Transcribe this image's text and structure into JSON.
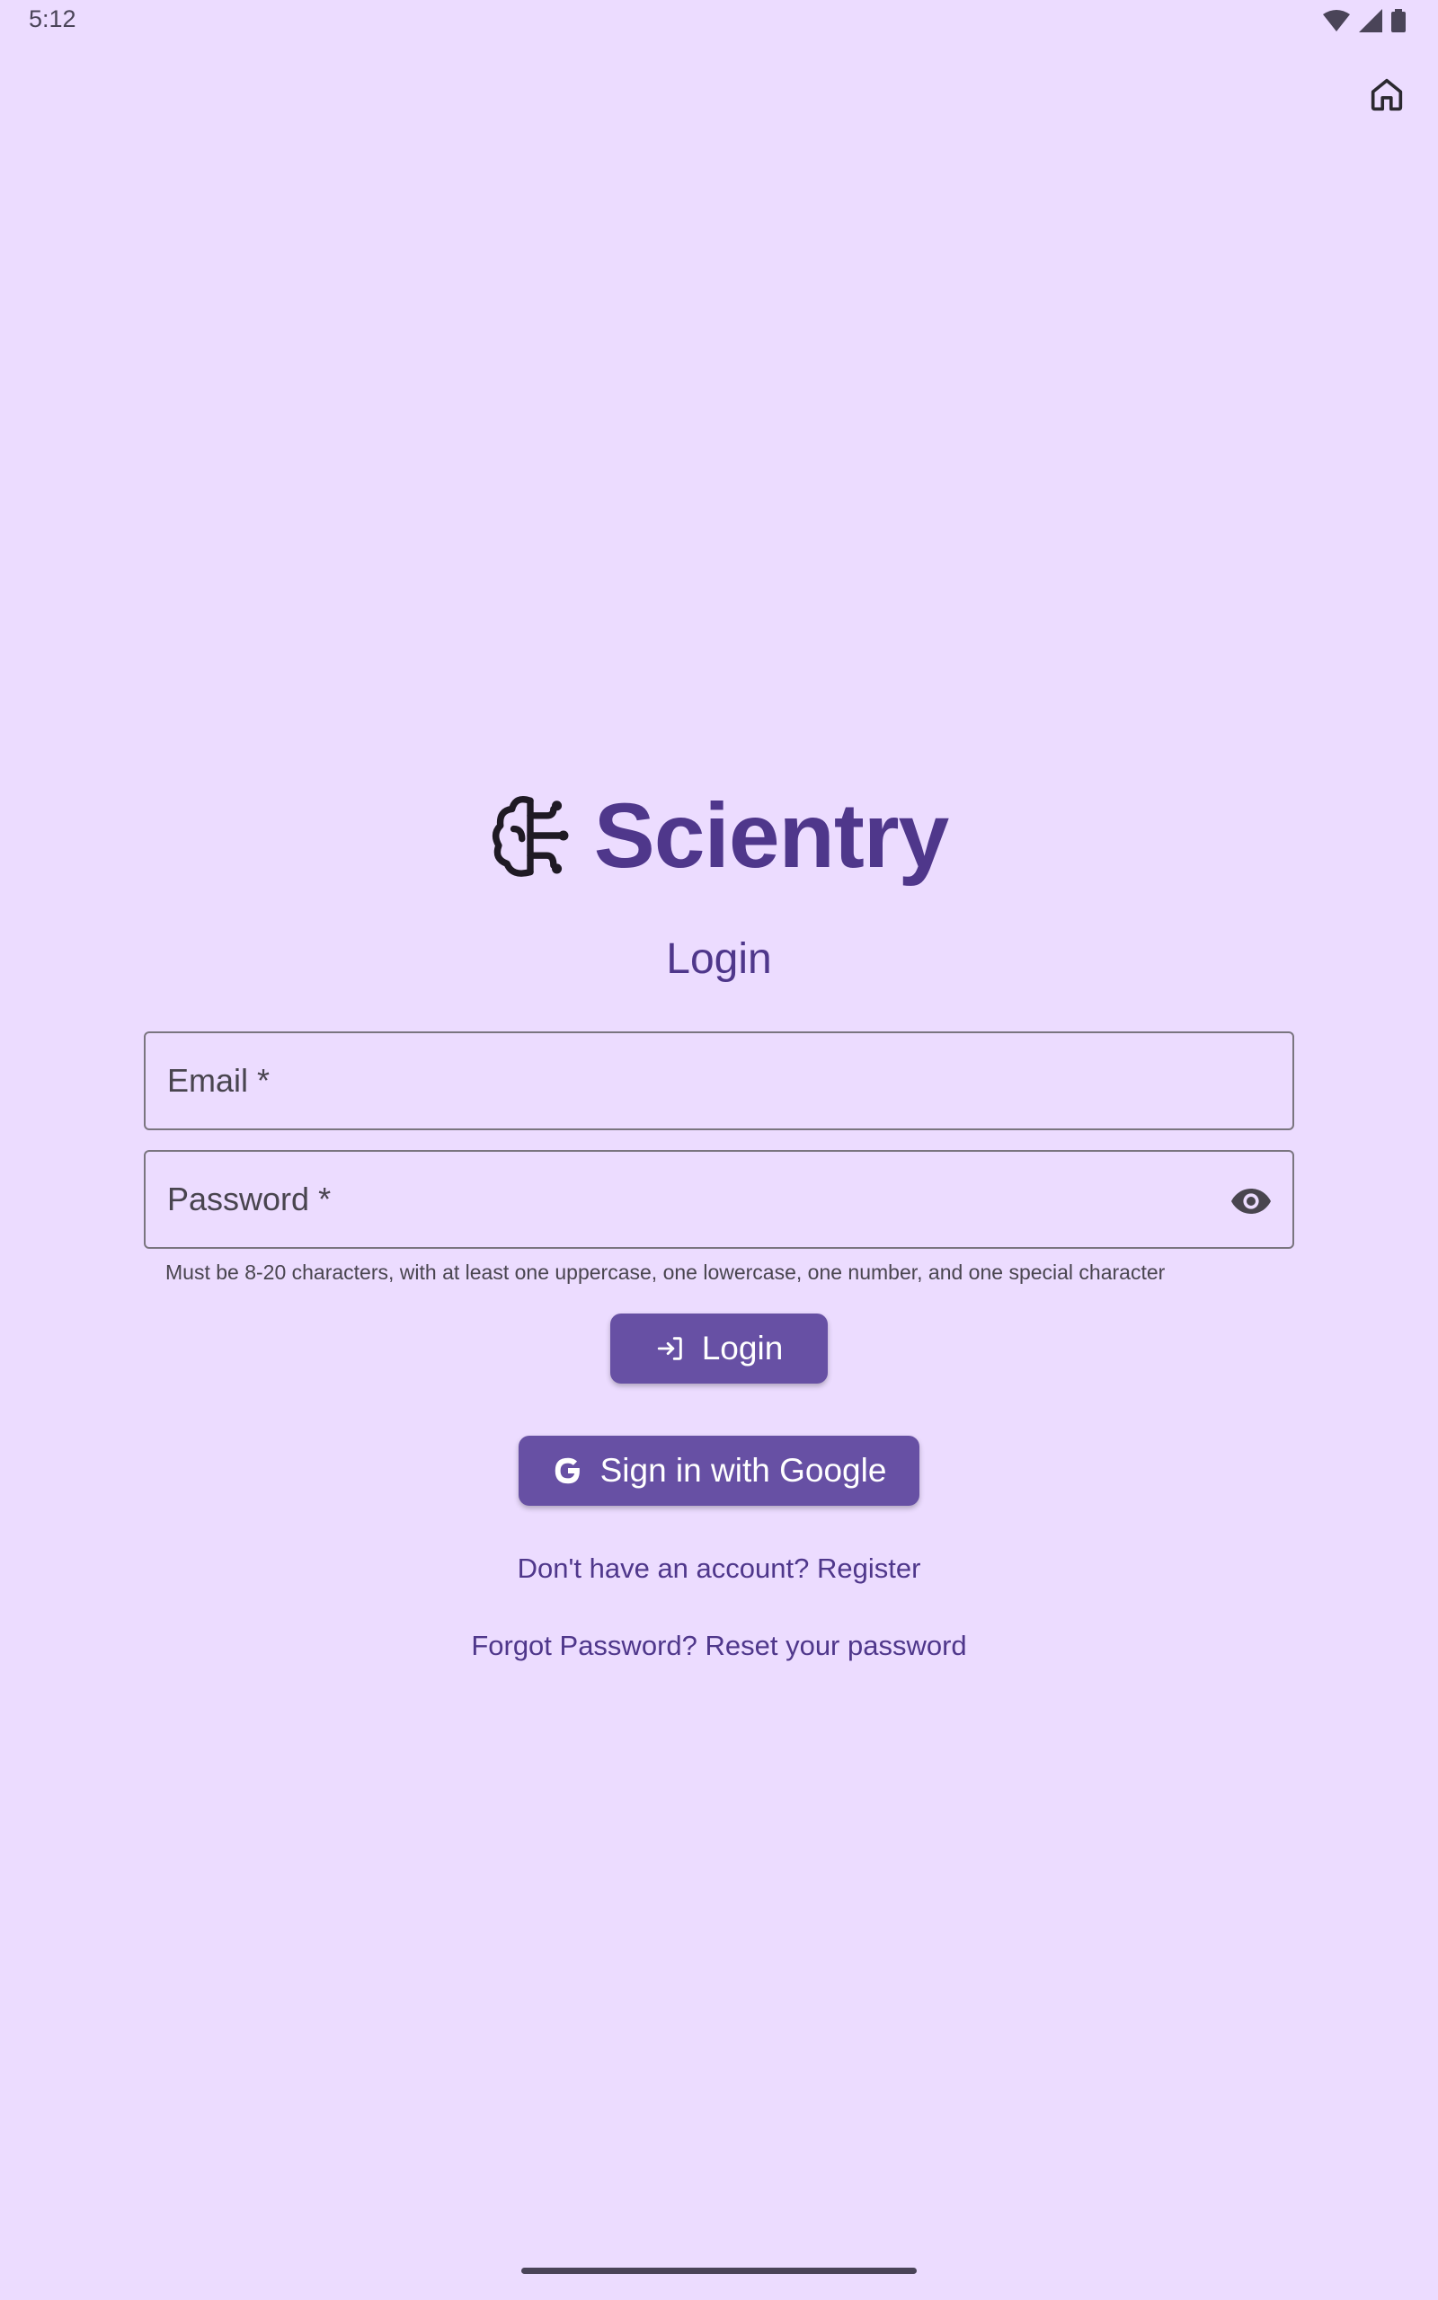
{
  "status_bar": {
    "time": "5:12",
    "icons": [
      "wifi-icon",
      "signal-icon",
      "battery-icon"
    ]
  },
  "top_bar": {
    "home_icon": "home-icon"
  },
  "brand": {
    "logo_icon": "brain-icon",
    "name": "Scientry"
  },
  "page_title": "Login",
  "form": {
    "email": {
      "label": "Email *",
      "value": ""
    },
    "password": {
      "label": "Password *",
      "value": "",
      "toggle_icon": "eye-icon"
    },
    "password_helper": "Must be 8-20 characters, with at least one uppercase, one lowercase, one number, and one special character"
  },
  "buttons": {
    "login": {
      "label": "Login",
      "icon": "login-icon"
    },
    "google": {
      "label": "Sign in with Google",
      "icon": "google-icon"
    }
  },
  "links": {
    "register": "Don't have an account? Register",
    "reset": "Forgot Password? Reset your password"
  },
  "colors": {
    "background": "#ecdcff",
    "primary": "#6750a4",
    "brand_text": "#4f378b"
  }
}
